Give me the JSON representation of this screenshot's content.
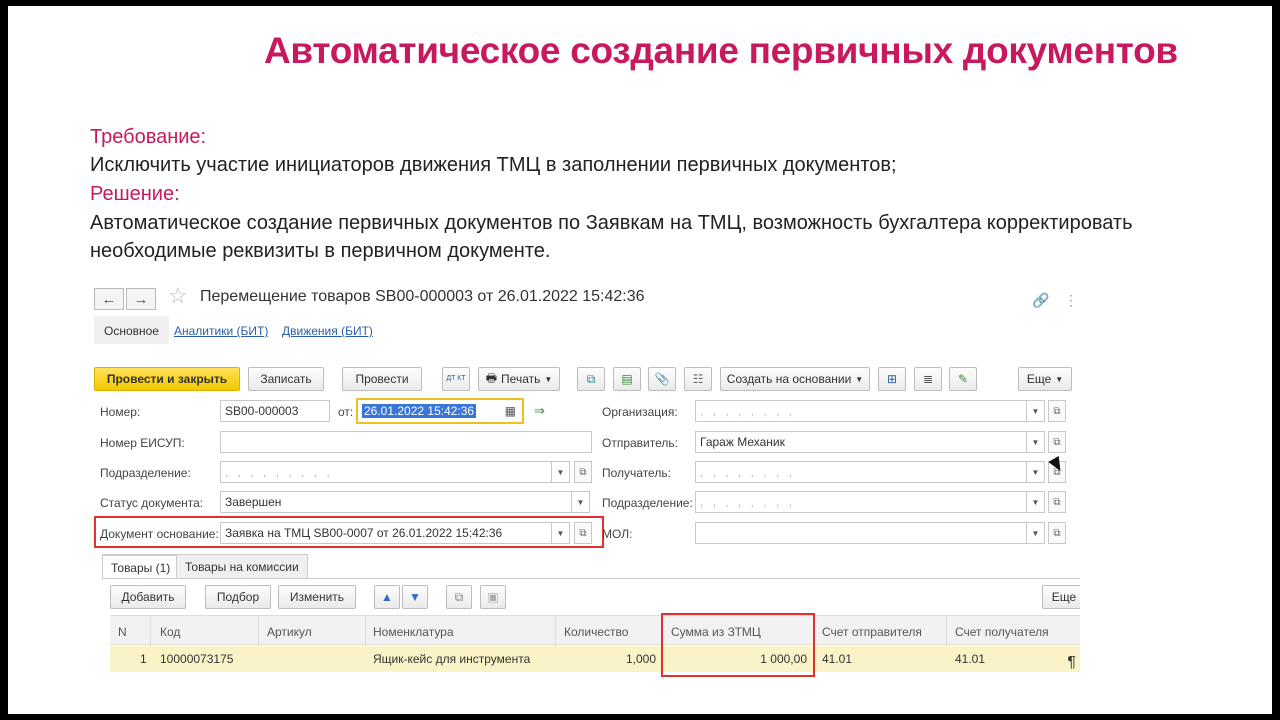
{
  "slide": {
    "title": "Автоматическое создание первичных документов",
    "requirement_label": "Требование:",
    "requirement_text": "Исключить участие инициаторов движения ТМЦ в заполнении первичных документов;",
    "solution_label": "Решение:",
    "solution_text_1": "Автоматическое создание первичных документов по Заявкам на ТМЦ, возможность бухгалтера корректировать",
    "solution_text_2": "необходимые реквизиты в первичном документе."
  },
  "form": {
    "nav": {
      "back": "←",
      "forward": "→",
      "star": "☆"
    },
    "title": "Перемещение товаров SB00-000003 от 26.01.2022 15:42:36",
    "top_icons": {
      "link": "🔗",
      "more": "⋮"
    },
    "tabs": [
      "Основное",
      "Аналитики (БИТ)",
      "Движения (БИТ)"
    ],
    "toolbar": {
      "post_close": "Провести и закрыть",
      "save": "Записать",
      "post": "Провести",
      "dt_kt": "ДТ КТ",
      "print": "Печать",
      "create_based": "Создать на основании",
      "more": "Еще"
    },
    "fields": {
      "number_label": "Номер:",
      "number_value": "SB00-000003",
      "date_from_label": "от:",
      "date_value": "26.01.2022 15:42:36",
      "eisup_label": "Номер ЕИСУП:",
      "eisup_value": "",
      "subdivision_label": "Подразделение:",
      "status_label": "Статус документа:",
      "status_value": "Завершен",
      "base_doc_label": "Документ основание:",
      "base_doc_value": "Заявка на ТМЦ SB00-0007 от 26.01.2022 15:42:36",
      "org_label": "Организация:",
      "sender_label": "Отправитель:",
      "sender_value": "Гараж Механик",
      "receiver_label": "Получатель:",
      "subdivision2_label": "Подразделение:",
      "mol_label": "МОЛ:",
      "mol_value": ""
    },
    "panel_tabs": [
      "Товары (1)",
      "Товары на комиссии"
    ],
    "table_toolbar": {
      "add": "Добавить",
      "pick": "Подбор",
      "change": "Изменить",
      "more": "Еще"
    },
    "table": {
      "columns": [
        "N",
        "Код",
        "Артикул",
        "Номенклатура",
        "Количество",
        "Сумма из ЗТМЦ",
        "Счет отправителя",
        "Счет получателя"
      ],
      "rows": [
        {
          "n": "1",
          "code": "10000073175",
          "article": "",
          "nomenclature": "Ящик-кейс  для инструмента",
          "quantity": "1,000",
          "sum": "1 000,00",
          "sender_account": "41.01",
          "receiver_account": "41.01"
        }
      ]
    },
    "pilcrow": "¶"
  }
}
